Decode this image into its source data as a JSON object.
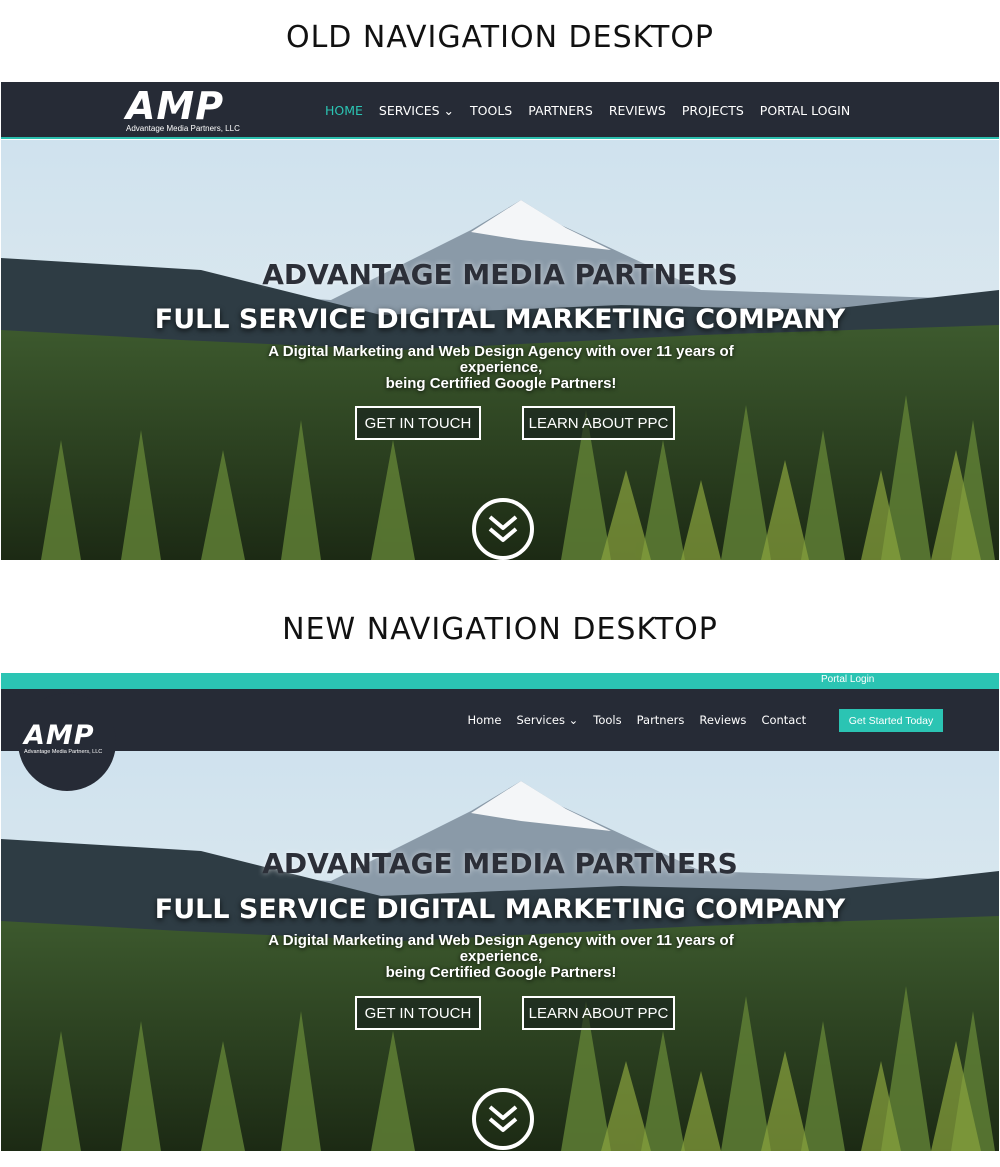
{
  "sections": {
    "old_heading": "OLD NAVIGATION DESKTOP",
    "new_heading": "NEW NAVIGATION DESKTOP"
  },
  "logo": {
    "wordmark": "AMP",
    "tagline": "Advantage Media Partners, LLC"
  },
  "old_nav": {
    "items": [
      {
        "label": "HOME",
        "active": true
      },
      {
        "label": "SERVICES ⌄",
        "active": false
      },
      {
        "label": "TOOLS",
        "active": false
      },
      {
        "label": "PARTNERS",
        "active": false
      },
      {
        "label": "REVIEWS",
        "active": false
      },
      {
        "label": "PROJECTS",
        "active": false
      },
      {
        "label": "PORTAL LOGIN",
        "active": false
      }
    ]
  },
  "new_nav": {
    "top_bar_link": "Portal Login",
    "items": [
      {
        "label": "Home"
      },
      {
        "label": "Services ⌄"
      },
      {
        "label": "Tools"
      },
      {
        "label": "Partners"
      },
      {
        "label": "Reviews"
      },
      {
        "label": "Contact"
      }
    ],
    "cta": "Get Started Today"
  },
  "hero": {
    "title": "ADVANTAGE MEDIA PARTNERS",
    "subtitle": "FULL SERVICE DIGITAL MARKETING COMPANY",
    "description_line1": "A Digital Marketing and Web Design Agency with over 11 years of experience,",
    "description_line2": "being Certified Google Partners!",
    "button_primary": "GET IN TOUCH",
    "button_secondary": "LEARN ABOUT PPC",
    "scroll_icon": "double-chevron-down-icon"
  },
  "colors": {
    "nav_bg": "#262b36",
    "accent": "#2bc4b3",
    "heading_text": "#111111",
    "hero_title": "#2c2f38"
  }
}
